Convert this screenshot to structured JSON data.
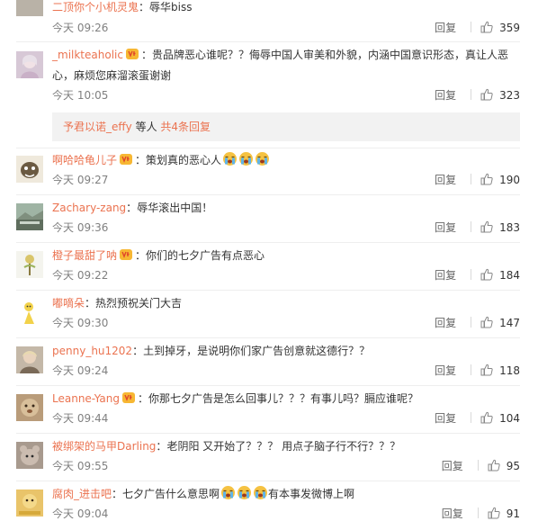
{
  "comments": [
    {
      "user": "二顶你个小机灵鬼",
      "sep": "：",
      "text": "辱华biss",
      "time": "今天 09:26",
      "reply": "回复",
      "likes": "359",
      "badge": false,
      "emoji_count": 0,
      "tail": ""
    },
    {
      "user": "_milkteaholic",
      "sep": "：",
      "text": "贵品牌恶心谁呢？？侮辱中国人审美和外貌，内涵中国意识形态，真让人恶心，麻烦您麻溜滚蛋谢谢",
      "time": "今天 10:05",
      "reply": "回复",
      "likes": "323",
      "badge": true,
      "emoji_count": 0,
      "tail": ""
    },
    {
      "user": "啊哈哈龟儿子",
      "sep": "：",
      "text": "策划真的恶心人",
      "time": "今天 09:27",
      "reply": "回复",
      "likes": "190",
      "badge": true,
      "emoji_count": 3,
      "tail": ""
    },
    {
      "user": "Zachary-zang",
      "sep": "：",
      "text": "辱华滚出中国！",
      "time": "今天 09:36",
      "reply": "回复",
      "likes": "183",
      "badge": false,
      "emoji_count": 0,
      "tail": ""
    },
    {
      "user": "橙子最甜了呐",
      "sep": "：",
      "text": "你们的七夕广告有点恶心",
      "time": "今天 09:22",
      "reply": "回复",
      "likes": "184",
      "badge": true,
      "emoji_count": 0,
      "tail": ""
    },
    {
      "user": "嘟嘀朵",
      "sep": "：",
      "text": "热烈预祝关门大吉",
      "time": "今天 09:30",
      "reply": "回复",
      "likes": "147",
      "badge": false,
      "emoji_count": 0,
      "tail": ""
    },
    {
      "user": "penny_hu1202",
      "sep": "：",
      "text": "土到掉牙，是说明你们家广告创意就这德行？？",
      "time": "今天 09:24",
      "reply": "回复",
      "likes": "118",
      "badge": false,
      "emoji_count": 0,
      "tail": ""
    },
    {
      "user": "Leanne-Yang",
      "sep": "：",
      "text": "你那七夕广告是怎么回事儿？？？有事儿吗？膈应谁呢？",
      "time": "今天 09:44",
      "reply": "回复",
      "likes": "104",
      "badge": true,
      "emoji_count": 0,
      "tail": ""
    },
    {
      "user": "被绑架的马甲Darling",
      "sep": "：",
      "text": "老阴阳 又开始了？？？ 用点子脑子行不行？？？",
      "time": "今天 09:55",
      "reply": "回复",
      "likes": "95",
      "badge": false,
      "emoji_count": 0,
      "tail": ""
    },
    {
      "user": "腐肉_进击吧",
      "sep": "：",
      "text": "七夕广告什么意思啊",
      "time": "今天 09:04",
      "reply": "回复",
      "likes": "91",
      "badge": false,
      "emoji_count": 3,
      "tail": "有本事发微博上啊"
    }
  ],
  "more_replies": {
    "names": "予君以诺_effy",
    "etc": " 等人 ",
    "count": "共4条回复"
  },
  "colors": {
    "username": "#eb7350",
    "meta": "#808080",
    "divider": "#eeeeee",
    "replies_bg": "#f2f2f2"
  }
}
